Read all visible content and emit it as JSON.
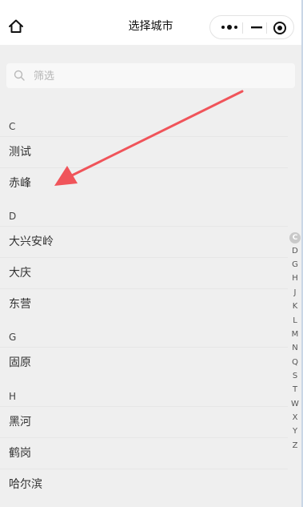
{
  "header": {
    "title": "选择城市",
    "home_icon": "home-icon",
    "more_icon": "more-dots-icon",
    "minimize_icon": "minimize-icon",
    "close_icon": "target-close-icon"
  },
  "search": {
    "placeholder": "筛选",
    "value": "",
    "icon": "search-icon"
  },
  "sections": [
    {
      "letter": "C",
      "cities": [
        "测试",
        "赤峰"
      ]
    },
    {
      "letter": "D",
      "cities": [
        "大兴安岭",
        "大庆",
        "东营"
      ]
    },
    {
      "letter": "G",
      "cities": [
        "固原"
      ]
    },
    {
      "letter": "H",
      "cities": [
        "黑河",
        "鹤岗",
        "哈尔滨"
      ]
    }
  ],
  "index_letters": [
    "C",
    "D",
    "G",
    "H",
    "J",
    "K",
    "L",
    "M",
    "N",
    "Q",
    "S",
    "T",
    "W",
    "X",
    "Y",
    "Z"
  ],
  "index_active": "C",
  "colors": {
    "arrow": "#f0545a",
    "header_bg": "#ffffff",
    "page_bg": "#efefef"
  }
}
